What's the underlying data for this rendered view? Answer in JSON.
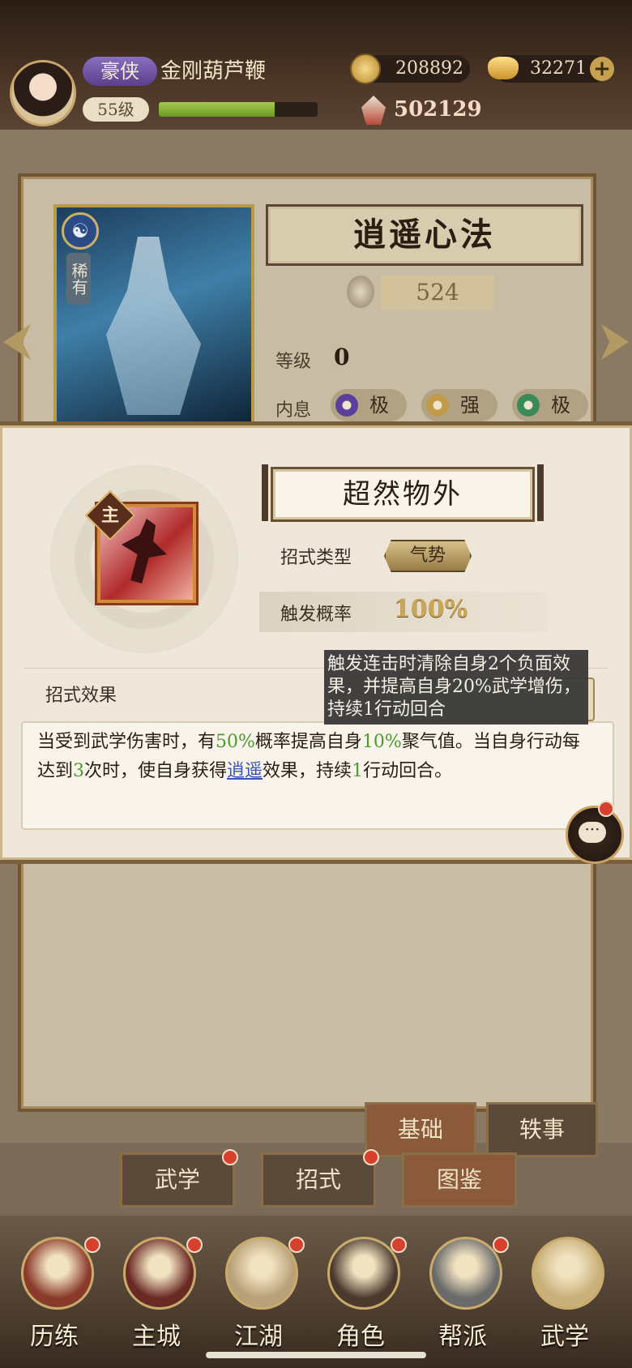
{
  "player": {
    "title": "豪侠",
    "name": "金刚葫芦鞭",
    "level": "55级",
    "exp_progress": 0.73,
    "coins": "208892",
    "ingots": "32271",
    "add_symbol": "+",
    "power": "502129"
  },
  "art": {
    "name": "逍遥心法",
    "rarity": "稀有",
    "element_symbol": "☯",
    "power": "524",
    "level_label": "等级",
    "level_value": "0",
    "neixi_label": "内息",
    "neixi": [
      {
        "text": "极",
        "color": "#5b3f9a"
      },
      {
        "text": "强",
        "color": "#c09a48"
      },
      {
        "text": "极",
        "color": "#3a8a5a"
      }
    ]
  },
  "tabs": {
    "basic": "基础",
    "story": "轶事",
    "wuxue": "武学",
    "zhaoshi": "招式",
    "tujian": "图鉴"
  },
  "popup": {
    "main_badge": "主",
    "skill_name": "超然物外",
    "type_label": "招式类型",
    "type_value": "气势",
    "rate_label": "触发概率",
    "rate_value": "100%",
    "effect_title": "招式效果",
    "effect": {
      "p1": "当受到武学伤害时，有",
      "g1": "50%",
      "p2": "概率提高自身",
      "g2": "10%",
      "p3": "聚气值。当自身行动每达到",
      "g3": "3",
      "p4": "次时，使自身获得",
      "link": "逍遥",
      "p5": "效果，持续",
      "g4": "1",
      "p6": "行动回合。"
    },
    "tooltip": "触发连击时清除自身2个负面效果，并提高自身20%武学增伤，持续1行动回合",
    "chat_icon": "···"
  },
  "bottom_nav": [
    {
      "label": "历练",
      "color": "#8a3a2a"
    },
    {
      "label": "主城",
      "color": "#6a2a24"
    },
    {
      "label": "江湖",
      "color": "#b8a078"
    },
    {
      "label": "角色",
      "color": "#4a3a2e"
    },
    {
      "label": "帮派",
      "color": "#6a6a6a"
    },
    {
      "label": "武学",
      "color": "#c9b07a"
    }
  ]
}
